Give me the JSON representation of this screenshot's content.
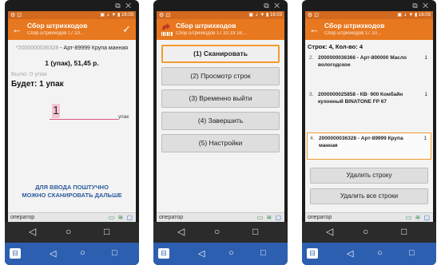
{
  "status": {
    "signal": "▣ ⇣ ▼ ▮",
    "time": "16:03"
  },
  "window_controls": "⧉ ✕",
  "screens": [
    {
      "title": "Сбор штрихкодов",
      "subtitle": "Сбор штрихкодов 17.10...",
      "item_code": "*2000000036328",
      "item_text": " - Арт-89999 Крупа манная",
      "qty_price": "1 (упак), 51,45 р.",
      "was": "Было: 0 упак",
      "now": "Будет: 1 упак",
      "input_value": "1",
      "unit": "упак",
      "hint_line1": "ДЛЯ ВВОДА ПОШТУЧНО",
      "hint_line2": "МОЖНО СКАНИРОВАТЬ ДАЛЬШЕ",
      "operator": "оператор"
    },
    {
      "title": "Сбор штрихкодов",
      "subtitle": "Сбор штрихкодов 17.10.19 16:...",
      "menu": [
        "(1) Сканировать",
        "(2) Просмотр строк",
        "(3) Временно выйти",
        "(4) Завершить",
        "(5) Настройки"
      ],
      "operator": "оператор"
    },
    {
      "title": "Сбор штрихкодов",
      "subtitle": "Сбор штрихкодов 17.10...",
      "header": "Строк: 4, Кол-во: 4",
      "rows": [
        {
          "num": "2.",
          "text": "2000000036366 - Арт-800000 Масло вологодское",
          "qty": "1"
        },
        {
          "num": "3.",
          "text": "2000000025858 - КВ- 900 Комбайн кухонный BINATONE FP 67",
          "qty": "1"
        },
        {
          "num": "4.",
          "text": "2000000036328 - Арт-89999 Крупа манная",
          "qty": "1"
        }
      ],
      "delete_row": "Удалить строку",
      "delete_all": "Удалить все строки",
      "operator": "оператор"
    }
  ],
  "nav": {
    "back": "◁",
    "home": "○",
    "recent": "□"
  },
  "colors": {
    "accent": "#e8781f",
    "highlight": "#f29b2f",
    "link": "#2e5d9f",
    "taskbar": "#2d5fb0"
  }
}
